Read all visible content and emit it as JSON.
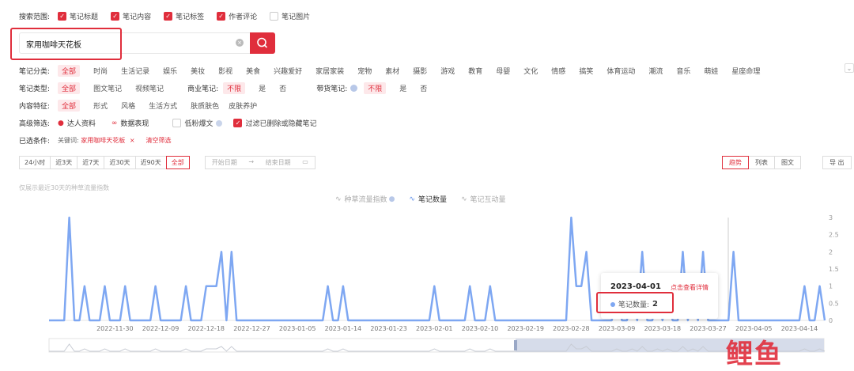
{
  "search_scope": {
    "label": "搜索范围:",
    "options": [
      {
        "label": "笔记标题",
        "checked": true
      },
      {
        "label": "笔记内容",
        "checked": true
      },
      {
        "label": "笔记标签",
        "checked": true
      },
      {
        "label": "作者评论",
        "checked": true
      },
      {
        "label": "笔记图片",
        "checked": false
      }
    ]
  },
  "search": {
    "value": "家用咖啡天花板"
  },
  "filters": {
    "category": {
      "label": "笔记分类:",
      "items": [
        "全部",
        "时尚",
        "生活记录",
        "娱乐",
        "美妆",
        "影视",
        "美食",
        "兴趣爱好",
        "家居家装",
        "宠物",
        "素材",
        "摄影",
        "游戏",
        "教育",
        "母婴",
        "文化",
        "情感",
        "搞笑",
        "体育运动",
        "潮流",
        "音乐",
        "萌娃",
        "星座命理"
      ]
    },
    "type": {
      "label": "笔记类型:",
      "items": [
        "全部",
        "图文笔记",
        "视频笔记"
      ],
      "commercial_label": "商业笔记:",
      "commercial": [
        "不限",
        "是",
        "否"
      ],
      "goods_label": "带货笔记:",
      "goods": [
        "不限",
        "是",
        "否"
      ]
    },
    "content": {
      "label": "内容特征:",
      "items": [
        "全部",
        "形式",
        "风格",
        "生活方式",
        "肤质肤色",
        "皮肤养护"
      ]
    },
    "advanced": {
      "label": "高级筛选:",
      "expert": "达人资料",
      "data": "数据表现",
      "low_fans": "低粉爆文",
      "filter_deleted": "过滤已删除或隐藏笔记"
    },
    "selected": {
      "label": "已选条件:",
      "keyword_prefix": "关键词:",
      "keyword": "家用咖啡天花板",
      "clear": "清空筛选"
    }
  },
  "time_range": {
    "buttons": [
      "24小时",
      "近3天",
      "近7天",
      "近30天",
      "近90天",
      "全部"
    ],
    "active": "全部",
    "start_placeholder": "开始日期",
    "end_placeholder": "结束日期"
  },
  "views": {
    "buttons": [
      "趋势",
      "列表",
      "图文"
    ],
    "active": "趋势",
    "export": "导 出"
  },
  "chart_note": "仅展示最近30天的种草流量指数",
  "legend": [
    {
      "name": "种草流量指数",
      "active": false
    },
    {
      "name": "笔记数量",
      "active": true
    },
    {
      "name": "笔记互动量",
      "active": false
    }
  ],
  "tooltip": {
    "date": "2023-04-01",
    "link": "点击查看详情",
    "label": "笔记数量:",
    "value": "2"
  },
  "colors": {
    "accent": "#e02e3c",
    "line": "#7ea7f2"
  },
  "chart_data": {
    "type": "line",
    "x_tick_labels": [
      "2022-11-30",
      "2022-12-09",
      "2022-12-18",
      "2022-12-27",
      "2023-01-05",
      "2023-01-14",
      "2023-01-23",
      "2023-02-01",
      "2023-02-10",
      "2023-02-19",
      "2023-02-28",
      "2023-03-09",
      "2023-03-18",
      "2023-03-27",
      "2023-04-05",
      "2023-04-14"
    ],
    "y_ticks": [
      0,
      0.5,
      1,
      1.5,
      2,
      2.5,
      3
    ],
    "ylim": [
      0,
      3
    ],
    "series": [
      {
        "name": "笔记数量",
        "points": [
          [
            "2022-11-21",
            3
          ],
          [
            "2022-11-24",
            1
          ],
          [
            "2022-11-28",
            1
          ],
          [
            "2022-12-02",
            1
          ],
          [
            "2022-12-08",
            1
          ],
          [
            "2022-12-14",
            1
          ],
          [
            "2022-12-18",
            1
          ],
          [
            "2022-12-19",
            1
          ],
          [
            "2022-12-20",
            1
          ],
          [
            "2022-12-21",
            2
          ],
          [
            "2022-12-23",
            2
          ],
          [
            "2023-01-11",
            1
          ],
          [
            "2023-01-14",
            1
          ],
          [
            "2023-02-01",
            1
          ],
          [
            "2023-02-08",
            1
          ],
          [
            "2023-02-12",
            1
          ],
          [
            "2023-02-28",
            3
          ],
          [
            "2023-03-01",
            1
          ],
          [
            "2023-03-02",
            1
          ],
          [
            "2023-03-03",
            2
          ],
          [
            "2023-03-09",
            1
          ],
          [
            "2023-03-12",
            1
          ],
          [
            "2023-03-14",
            2
          ],
          [
            "2023-03-17",
            1
          ],
          [
            "2023-03-19",
            1
          ],
          [
            "2023-03-22",
            2
          ],
          [
            "2023-03-24",
            1
          ],
          [
            "2023-03-26",
            2
          ],
          [
            "2023-04-01",
            2
          ],
          [
            "2023-04-15",
            1
          ],
          [
            "2023-04-18",
            1
          ]
        ]
      }
    ]
  }
}
